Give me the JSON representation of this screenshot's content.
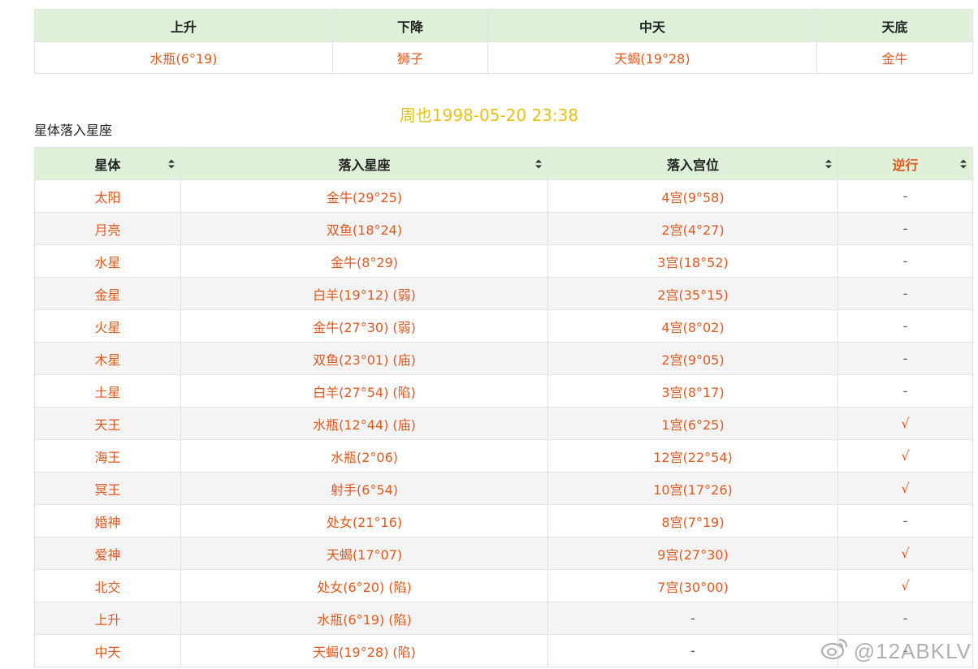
{
  "angles": {
    "headers": [
      "上升",
      "下降",
      "中天",
      "天底"
    ],
    "values": [
      "水瓶(6°19)",
      "狮子",
      "天蝎(19°28)",
      "金牛"
    ]
  },
  "chart_title": "周也1998-05-20 23:38",
  "section_caption": "星体落入星座",
  "planets": {
    "headers": [
      "星体",
      "落入星座",
      "落入宫位",
      "逆行"
    ],
    "rows": [
      {
        "body": "太阳",
        "sign": "金牛(29°25)",
        "house": "4宫(9°58)",
        "retro": "-"
      },
      {
        "body": "月亮",
        "sign": "双鱼(18°24)",
        "house": "2宫(4°27)",
        "retro": "-"
      },
      {
        "body": "水星",
        "sign": "金牛(8°29)",
        "house": "3宫(18°52)",
        "retro": "-"
      },
      {
        "body": "金星",
        "sign": "白羊(19°12) (弱)",
        "house": "2宫(35°15)",
        "retro": "-"
      },
      {
        "body": "火星",
        "sign": "金牛(27°30) (弱)",
        "house": "4宫(8°02)",
        "retro": "-"
      },
      {
        "body": "木星",
        "sign": "双鱼(23°01) (庙)",
        "house": "2宫(9°05)",
        "retro": "-"
      },
      {
        "body": "土星",
        "sign": "白羊(27°54) (陷)",
        "house": "3宫(8°17)",
        "retro": "-"
      },
      {
        "body": "天王",
        "sign": "水瓶(12°44) (庙)",
        "house": "1宫(6°25)",
        "retro": "√"
      },
      {
        "body": "海王",
        "sign": "水瓶(2°06)",
        "house": "12宫(22°54)",
        "retro": "√"
      },
      {
        "body": "冥王",
        "sign": "射手(6°54)",
        "house": "10宫(17°26)",
        "retro": "√"
      },
      {
        "body": "婚神",
        "sign": "处女(21°16)",
        "house": "8宫(7°19)",
        "retro": "-"
      },
      {
        "body": "爱神",
        "sign": "天蝎(17°07)",
        "house": "9宫(27°30)",
        "retro": "√"
      },
      {
        "body": "北交",
        "sign": "处女(6°20) (陷)",
        "house": "7宫(30°00)",
        "retro": "√"
      },
      {
        "body": "上升",
        "sign": "水瓶(6°19) (陷)",
        "house": "-",
        "retro": "-"
      },
      {
        "body": "中天",
        "sign": "天蝎(19°28) (陷)",
        "house": "-",
        "retro": "-"
      }
    ]
  },
  "watermark": "@12ABKLV",
  "icons": {
    "sort": "sort-icon",
    "watermark": "weibo-icon"
  },
  "colors": {
    "header_bg": "#dff0d8",
    "accent_text": "#e05a20",
    "title": "#e8c01a",
    "stripe": "#f4f4f4"
  }
}
